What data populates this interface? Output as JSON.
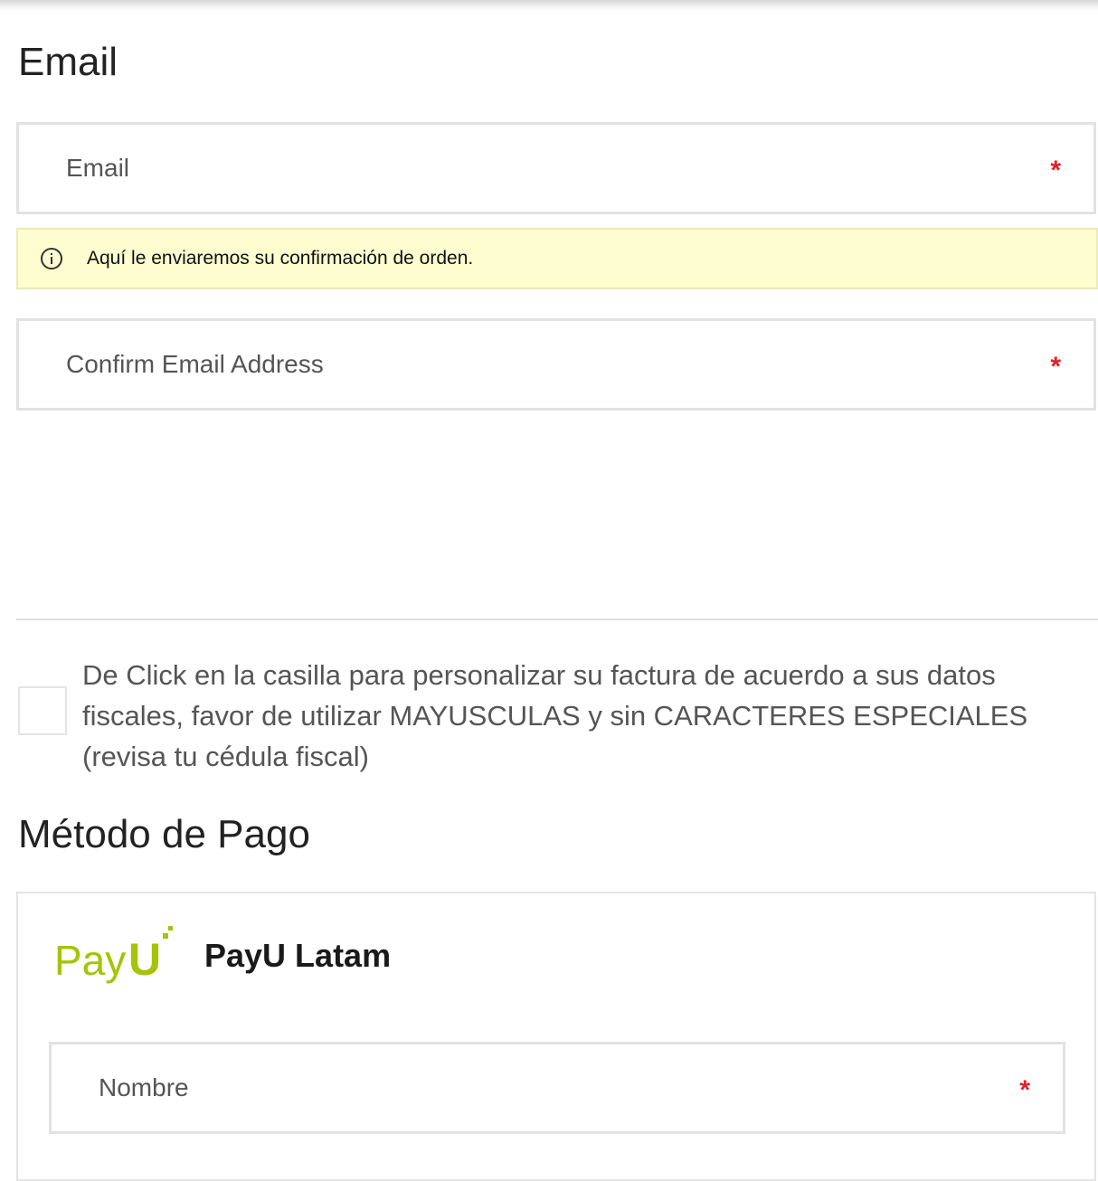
{
  "email_section": {
    "title": "Email",
    "email_field": {
      "placeholder": "Email",
      "value": "",
      "required_mark": "*"
    },
    "notice": {
      "text": "Aquí le enviaremos su confirmación de orden."
    },
    "confirm_field": {
      "placeholder": "Confirm Email Address",
      "value": "",
      "required_mark": "*"
    }
  },
  "invoice": {
    "checked": false,
    "label": "De Click en la casilla para personalizar su factura de acuerdo a sus datos fiscales, favor de utilizar MAYUSCULAS y sin CARACTERES ESPECIALES (revisa tu cédula fiscal)"
  },
  "payment": {
    "title": "Método de Pago",
    "provider": {
      "logo_text_main": "Pay",
      "logo_text_accent": "U",
      "name": "PayU Latam"
    },
    "name_field": {
      "placeholder": "Nombre",
      "value": "",
      "required_mark": "*"
    }
  },
  "colors": {
    "required": "#e0202a",
    "notice_bg": "#fdfdd0",
    "payu_green": "#a6c307"
  },
  "icons": {
    "notice": "info-circle-icon"
  }
}
